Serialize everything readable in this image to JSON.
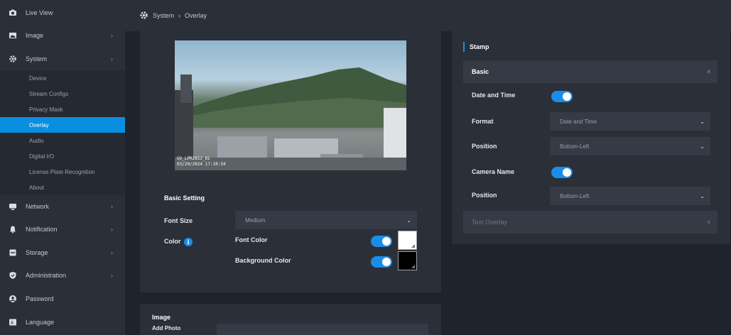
{
  "sidebar": {
    "items": [
      {
        "label": "Live View",
        "icon": "camera-icon"
      },
      {
        "label": "Image",
        "icon": "image-icon"
      },
      {
        "label": "System",
        "icon": "gear-icon"
      },
      {
        "label": "Network",
        "icon": "monitor-icon"
      },
      {
        "label": "Notification",
        "icon": "bell-icon"
      },
      {
        "label": "Storage",
        "icon": "storage-icon"
      },
      {
        "label": "Administration",
        "icon": "shield-icon"
      },
      {
        "label": "Password",
        "icon": "user-icon"
      },
      {
        "label": "Language",
        "icon": "language-icon"
      }
    ],
    "submenu": [
      {
        "label": "Device"
      },
      {
        "label": "Stream Configs"
      },
      {
        "label": "Privacy Mask"
      },
      {
        "label": "Overlay"
      },
      {
        "label": "Audio"
      },
      {
        "label": "Digital I/O"
      },
      {
        "label": "License Plate Recognition"
      },
      {
        "label": "About"
      }
    ],
    "chevron": "›"
  },
  "breadcrumb": {
    "root": "System",
    "separator": "›",
    "current": "Overlay"
  },
  "preview": {
    "osd_line1": "GV_LPR2812_DL",
    "osd_line2": "03/20/2024 17:10:34"
  },
  "basic_setting": {
    "title": "Basic Setting",
    "font_size_label": "Font Size",
    "font_size_value": "Medium",
    "color_label": "Color",
    "info_glyph": "i",
    "font_color_label": "Font Color",
    "font_color_enabled": true,
    "font_color_value": "#ffffff",
    "background_color_label": "Background Color",
    "background_color_enabled": true,
    "background_color_value": "#000000"
  },
  "image_section": {
    "title": "Image",
    "add_photo_label": "Add Photo"
  },
  "stamp": {
    "title": "Stamp",
    "basic_label": "Basic",
    "basic_caret": "˄",
    "date_time_label": "Date and Time",
    "date_time_enabled": true,
    "format_label": "Format",
    "format_value": "Date and Time",
    "position1_label": "Position",
    "position1_value": "Bottom-Left",
    "camera_name_label": "Camera Name",
    "camera_name_enabled": true,
    "position2_label": "Position",
    "position2_value": "Bottom-Left",
    "text_overlay_label": "Text Overlay",
    "text_overlay_caret": "˅"
  },
  "dropdown_glyph": "⌄",
  "colors": {
    "accent": "#1a8de8",
    "active_menu": "#0a8fe0",
    "panel": "#2b2f38",
    "background": "#1f232b"
  }
}
